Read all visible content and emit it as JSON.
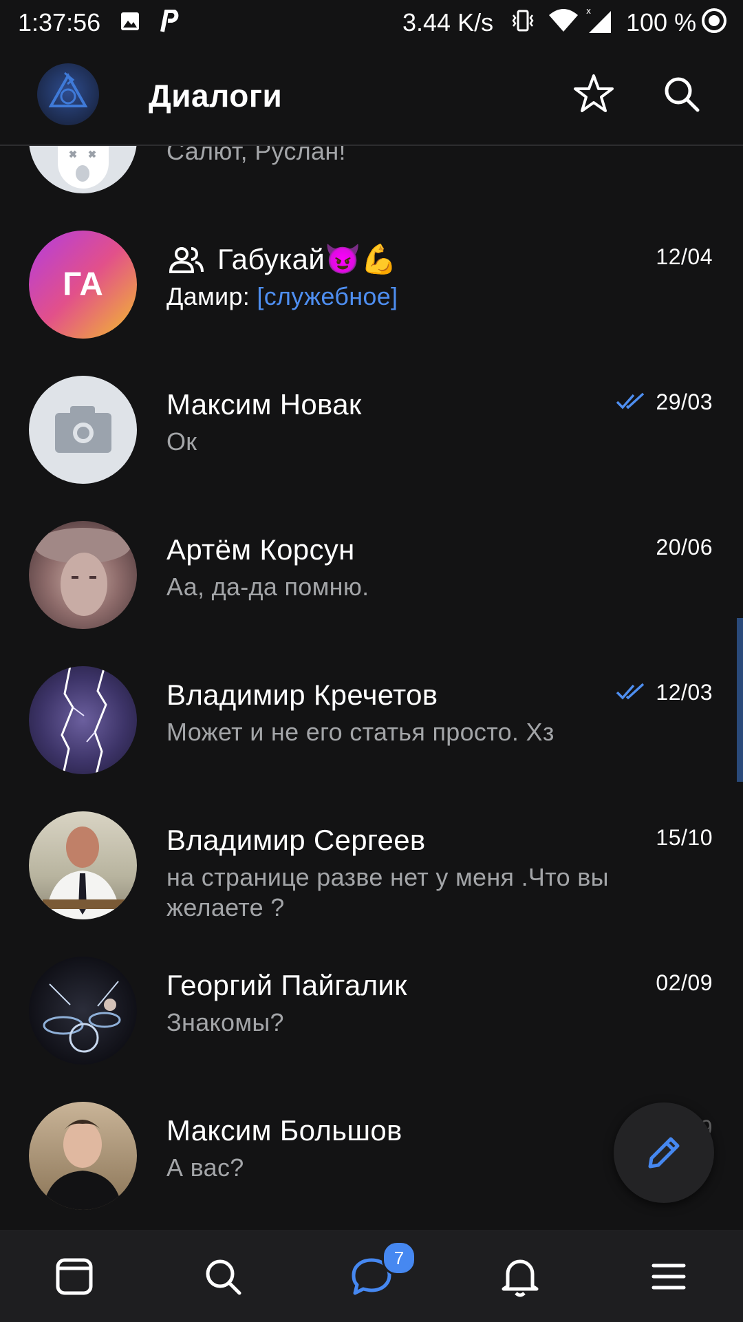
{
  "status_bar": {
    "time": "1:37:56",
    "speed": "3.44 K/s",
    "battery": "100 %",
    "icons": [
      "image-icon",
      "p-icon",
      "vibrate-icon",
      "wifi-icon",
      "signal-icon",
      "target-icon"
    ]
  },
  "header": {
    "title": "Диалоги",
    "icons": [
      "app-avatar",
      "star-icon",
      "search-icon"
    ]
  },
  "dialogs": [
    {
      "name": "",
      "message": "Салют, Руслан!",
      "date": "",
      "read": false
    },
    {
      "name": "Габукай😈💪",
      "group": true,
      "avatar_text": "ГА",
      "sender": "Дамир: ",
      "message": "[служебное]",
      "date": "12/04",
      "read": false
    },
    {
      "name": "Максим Новак",
      "message": "Ок",
      "date": "29/03",
      "read": true
    },
    {
      "name": "Артём Корсун",
      "message": "Аа, да-да помню.",
      "date": "20/06",
      "read": false
    },
    {
      "name": "Владимир Кречетов",
      "message": "Может и не его статья просто. Хз",
      "date": "12/03",
      "read": true
    },
    {
      "name": "Владимир Сергеев",
      "message": "на странице разве нет у меня .Что вы желаете ?",
      "date": "15/10",
      "read": false
    },
    {
      "name": "Георгий Пайгалик",
      "message": "Знакомы?",
      "date": "02/09",
      "read": false
    },
    {
      "name": "Максим Большов",
      "message": "А вас?",
      "date": "02/09",
      "read": true
    }
  ],
  "fab": {
    "icon": "pencil-icon"
  },
  "bottom_nav": {
    "items": [
      "feed-icon",
      "search-icon",
      "messages-icon",
      "bell-icon",
      "menu-icon"
    ],
    "active": "messages-icon",
    "messages_badge": "7"
  },
  "colors": {
    "background": "#131314",
    "accent": "#4688f1",
    "secondary_text": "#a3a5a8"
  }
}
